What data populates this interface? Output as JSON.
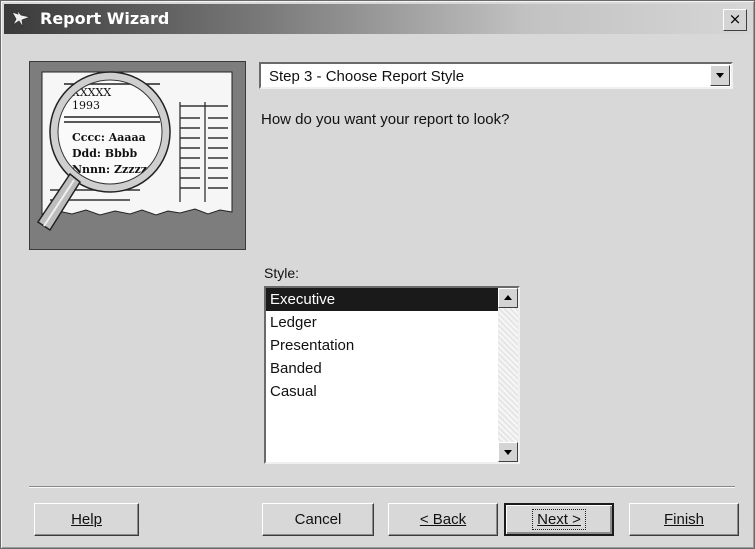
{
  "window": {
    "title": "Report Wizard",
    "close_glyph": "×",
    "icon": "wizard-icon"
  },
  "illustration": {
    "icon": "report-magnifier",
    "lines": [
      "XXXXX",
      "1993",
      "Cccc: Aaaaa",
      "Ddd: Bbbb",
      "Nnnn: Zzzzz"
    ]
  },
  "step_selector": {
    "value": "Step 3 - Choose Report Style"
  },
  "question": "How do you want your report to look?",
  "style": {
    "label": "Style:",
    "items": [
      "Executive",
      "Ledger",
      "Presentation",
      "Banded",
      "Casual"
    ],
    "selected": "Executive"
  },
  "buttons": {
    "help": "Help",
    "cancel": "Cancel",
    "back": "< Back",
    "next": "Next >",
    "finish": "Finish"
  }
}
